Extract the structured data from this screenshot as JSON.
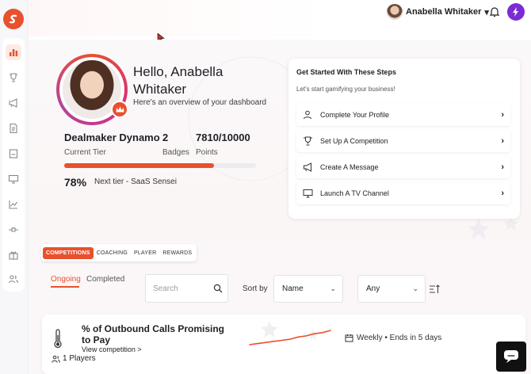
{
  "user": {
    "name": "Anabella Whitaker"
  },
  "header": {
    "chevron": "▾"
  },
  "hero": {
    "greeting": "Hello, Anabella Whitaker",
    "subtitle": "Here's an overview of your dashboard",
    "tier_value": "Dealmaker Dynamo",
    "tier_label": "Current Tier",
    "badges_value": "2",
    "badges_label": "Badges",
    "points_value": "7810/10000",
    "points_label": "Points",
    "progress_percent": 78,
    "progress_text": "78%",
    "next_tier": "Next tier - SaaS Sensei"
  },
  "steps": {
    "title": "Get Started With These Steps",
    "subtitle": "Let's start gamifying your business!",
    "items": [
      {
        "label": "Complete Your Profile",
        "icon": "user-icon"
      },
      {
        "label": "Set Up A Competition",
        "icon": "trophy-icon"
      },
      {
        "label": "Create A Message",
        "icon": "megaphone-icon"
      },
      {
        "label": "Launch A TV Channel",
        "icon": "monitor-icon"
      }
    ],
    "chevron": "›"
  },
  "tabs": {
    "items": [
      "COMPETITIONS",
      "COACHING",
      "PLAYER",
      "REWARDS"
    ],
    "active": "COMPETITIONS",
    "sub": [
      "Ongoing",
      "Completed"
    ],
    "sub_active": "Ongoing"
  },
  "filters": {
    "search_placeholder": "Search",
    "sort_label": "Sort by",
    "sort_value": "Name",
    "scope_value": "Any",
    "dropdown": "⌄"
  },
  "competition": {
    "title": "% of Outbound Calls Promising to Pay",
    "view_link": "View competition >",
    "players": "1 Players",
    "schedule": "Weekly • Ends in 5 days",
    "trend": [
      2,
      3,
      4,
      5,
      6,
      7,
      9,
      10,
      12,
      13,
      15
    ],
    "expand": "⌄"
  },
  "colors": {
    "brand": "#e9502d",
    "accent": "#7b2bd6"
  }
}
